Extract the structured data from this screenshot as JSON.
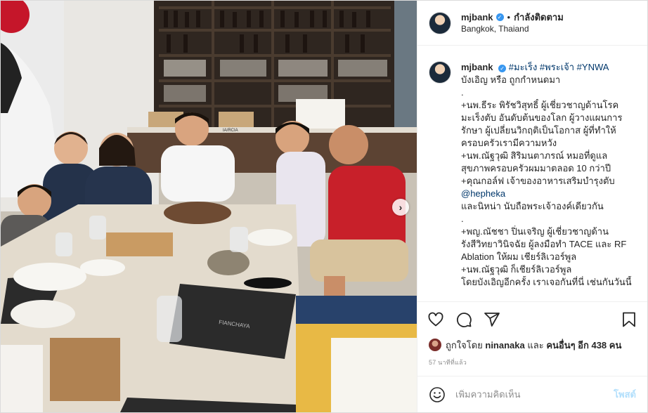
{
  "post": {
    "username": "mjbank",
    "follow_status": "กำลังติดตาม",
    "location": "Bangkok, Thaiand",
    "caption_hashtags": "#มะเร็ง #พระเจ้า #YNWA",
    "caption_lines": [
      "บังเอิญ หรือ ถูกกำหนดมา",
      ".",
      "+นพ.ธีระ พิรัชวิสุทธิ์ ผู้เชี่ยวชาญด้านโรค",
      "มะเร็งตับ อันดับต้นของโลก ผู้วางแผนการ",
      "รักษา ผู้เปลี่ยนวิกฤติเป็นโอกาส ผู้ที่ทำให้",
      "ครอบครัวเรามีความหวัง",
      "+นพ.ณัฐวุฒิ สิริมนตาภรณ์ หมอที่ดูแล",
      "สุขภาพครอบครัวผมมาตลอด 10 กว่าปี",
      "+คุณกอล์ฟ เจ้าของอาหารเสริมบำรุงตับ"
    ],
    "mention": "@hepheka",
    "caption_lines_2": [
      "และนิหน่า นับถือพระเจ้าองค์เดียวกัน",
      ".",
      "+พญ.ณัชชา ปิ่นเจริญ ผู้เชี่ยวชาญด้าน",
      "รังสีวิทยาวินิจฉัย ผู้ลงมือทำ TACE และ RF",
      "Ablation ให้ผม เชียร์ลิเวอร์พูล",
      "+นพ.ณัฐวุฒิ ก็เชียร์ลิเวอร์พูล",
      "โดยบังเอิญอีกครั้ง เราเจอกันที่นี่ เช่นกันวันนี้"
    ],
    "likes_prefix": "ถูกใจโดย",
    "likes_user": "ninanaka",
    "likes_and": "และ",
    "likes_others": "คนอื่นๆ อีก 438 คน",
    "timestamp": "57 นาทีที่แล้ว",
    "comment_placeholder": "เพิ่มความคิดเห็น",
    "post_button": "โพสต์"
  },
  "icons": {
    "verified": "verified-badge-icon",
    "heart": "heart-icon",
    "comment": "comment-icon",
    "share": "share-icon",
    "save": "bookmark-icon",
    "emoji": "emoji-icon",
    "next": "chevron-right-icon"
  },
  "photo": {
    "visible_signs": [
      "FIANCHAYA",
      "IA/RCIA"
    ]
  },
  "colors": {
    "link": "#00376b",
    "verified": "#3897f0",
    "post_button": "#b2dffc",
    "muted": "#8e8e8e"
  }
}
